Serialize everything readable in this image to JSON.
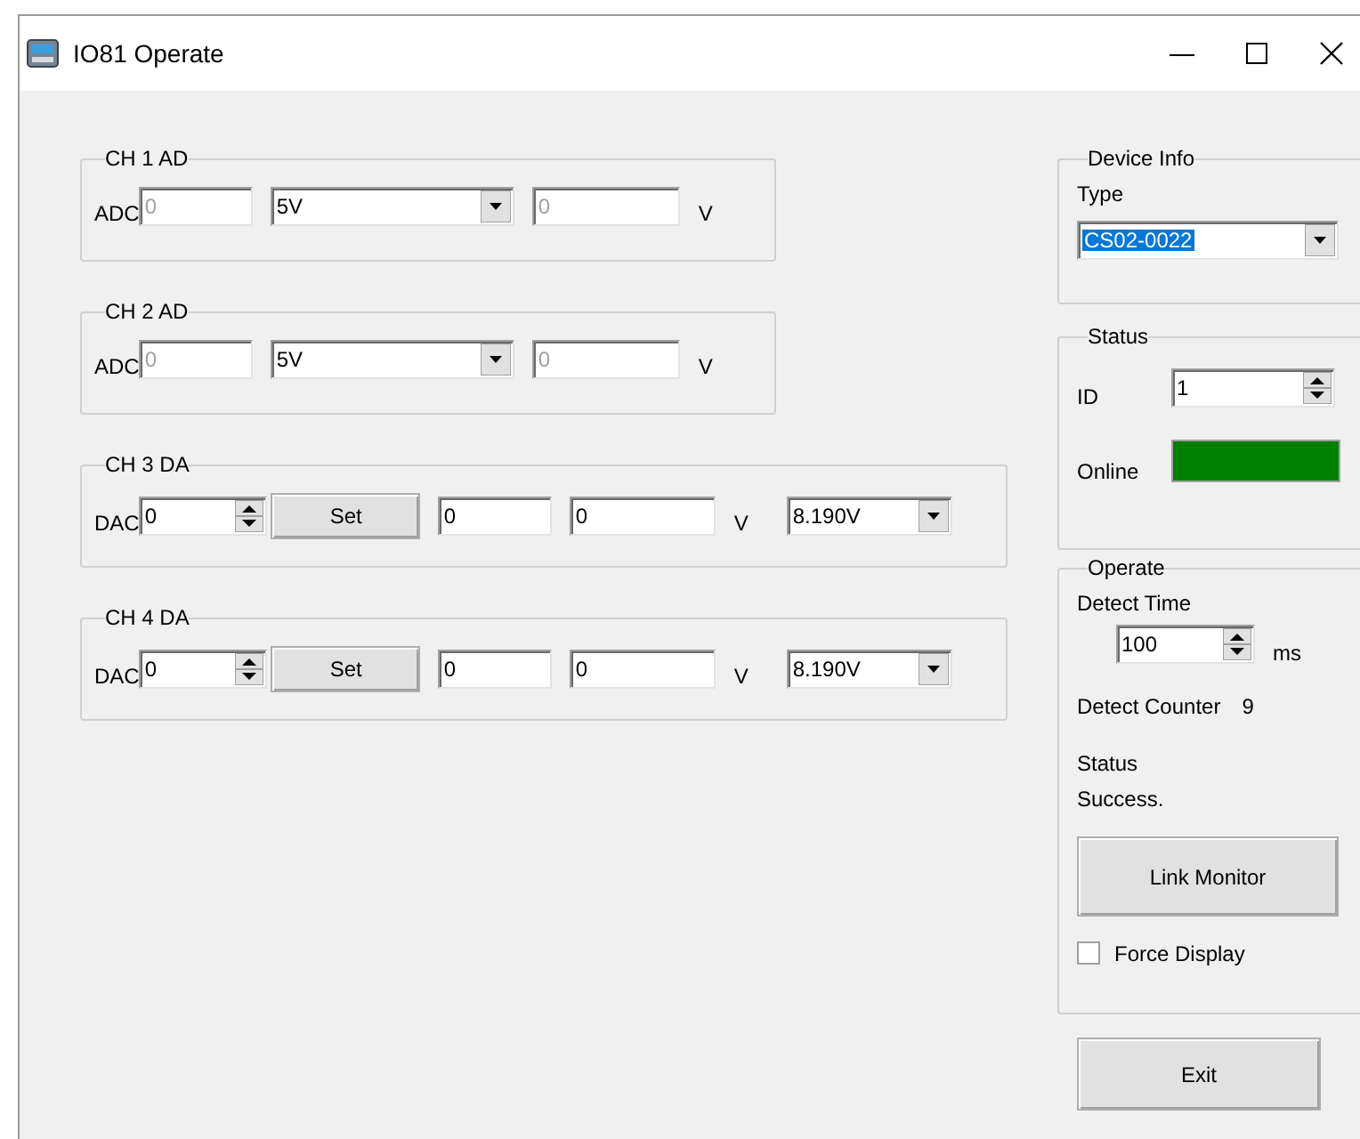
{
  "window": {
    "title": "IO81 Operate"
  },
  "channels": [
    {
      "title": "CH 1 AD",
      "controls": [
        {
          "kind": "label",
          "text": "ADC"
        },
        {
          "kind": "field",
          "value": "0",
          "disabled": true
        },
        {
          "kind": "combo",
          "value": "5V"
        },
        {
          "kind": "field",
          "value": "0",
          "disabled": true
        },
        {
          "kind": "unit",
          "text": "V"
        }
      ]
    },
    {
      "title": "CH 2 AD",
      "controls": [
        {
          "kind": "label",
          "text": "ADC"
        },
        {
          "kind": "field",
          "value": "0",
          "disabled": true
        },
        {
          "kind": "combo",
          "value": "5V"
        },
        {
          "kind": "field",
          "value": "0",
          "disabled": true
        },
        {
          "kind": "unit",
          "text": "V"
        }
      ]
    },
    {
      "title": "CH 3 DA",
      "controls": [
        {
          "kind": "label",
          "text": "DAC"
        },
        {
          "kind": "spin",
          "value": "0"
        },
        {
          "kind": "button",
          "text": "Set"
        },
        {
          "kind": "field",
          "value": "0",
          "disabled": false
        },
        {
          "kind": "field",
          "value": "0",
          "disabled": false
        },
        {
          "kind": "unit",
          "text": "V"
        },
        {
          "kind": "combo",
          "value": "8.190V"
        }
      ]
    },
    {
      "title": "CH 4 DA",
      "controls": [
        {
          "kind": "label",
          "text": "DAC"
        },
        {
          "kind": "spin",
          "value": "0"
        },
        {
          "kind": "button",
          "text": "Set"
        },
        {
          "kind": "field",
          "value": "0",
          "disabled": false
        },
        {
          "kind": "field",
          "value": "0",
          "disabled": false
        },
        {
          "kind": "unit",
          "text": "V"
        },
        {
          "kind": "combo",
          "value": "8.190V"
        }
      ]
    }
  ],
  "device_info": {
    "title": "Device Info",
    "type_label": "Type",
    "type_value": "CS02-0022",
    "highlighted": true
  },
  "status": {
    "title": "Status",
    "id_label": "ID",
    "id_value": "1",
    "online_label": "Online",
    "online": true
  },
  "operate": {
    "title": "Operate",
    "detect_time_label": "Detect Time",
    "detect_time_value": "100",
    "unit": "ms",
    "counter_label": "Detect Counter",
    "counter_value": "9",
    "status_label": "Status",
    "status_value": "Success.",
    "link_button": "Link Monitor",
    "force_display": {
      "label": "Force Display",
      "checked": false
    }
  },
  "exit_button": "Exit"
}
